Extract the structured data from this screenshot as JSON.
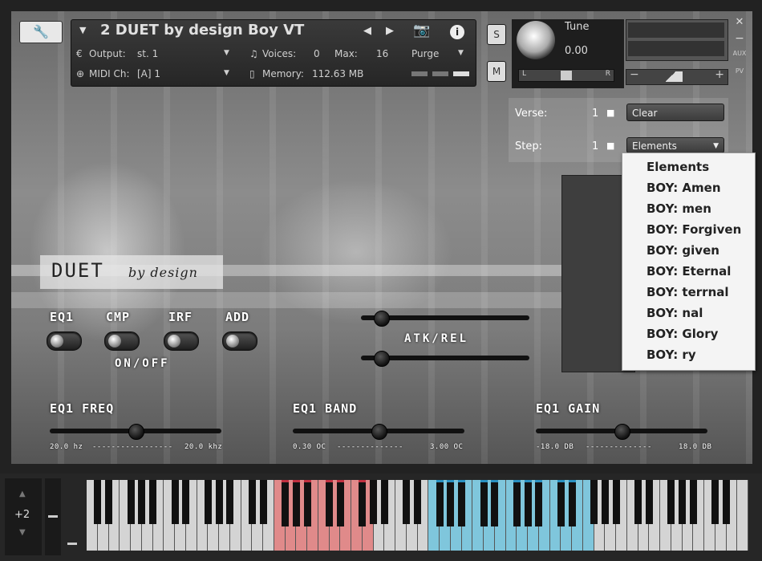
{
  "header": {
    "instrument_name": "2 DUET by design Boy VT",
    "output_label": "Output:",
    "output_value": "st. 1",
    "voices_label": "Voices:",
    "voices_value": "0",
    "max_label": "Max:",
    "max_value": "16",
    "purge_label": "Purge",
    "midi_label": "MIDI Ch:",
    "midi_value": "[A]  1",
    "memory_label": "Memory:",
    "memory_value": "112.63 MB",
    "s_label": "S",
    "m_label": "M",
    "tune_label": "Tune",
    "tune_value": "0.00",
    "pan_l": "L",
    "pan_r": "R",
    "aux_label": "AUX",
    "pv_label": "PV",
    "close_glyph": "✕",
    "minimize_glyph": "−"
  },
  "controls": {
    "verse_label": "Verse:",
    "verse_value": "1",
    "step_label": "Step:",
    "step_value": "1",
    "clear_label": "Clear",
    "elements_label": "Elements"
  },
  "dropdown": {
    "items": [
      "Elements",
      "BOY: Amen",
      "BOY: men",
      "BOY: Forgiven",
      "BOY: given",
      "BOY: Eternal",
      "BOY: terrnal",
      "BOY: nal",
      "BOY: Glory",
      "BOY: ry"
    ]
  },
  "logo": {
    "main": "DUET",
    "script": "by design"
  },
  "toggles": {
    "eq1": "EQ1",
    "cmp": "CMP",
    "irf": "IRF",
    "add": "ADD",
    "onoff": "ON/OFF",
    "atkrel": "ATK/REL"
  },
  "sliders": {
    "eq1_freq": {
      "label": "EQ1 FREQ",
      "min": "20.0 hz",
      "max": "20.0 khz",
      "level": 0.5
    },
    "eq1_band": {
      "label": "EQ1 BAND",
      "min": "0.30 OC",
      "max": "3.00 OC",
      "level": 0.5
    },
    "eq1_gain": {
      "label": "EQ1 GAIN",
      "min": "-18.0 DB",
      "max": "18.0 DB",
      "level": 0.5
    }
  },
  "keyboard": {
    "octave_value": "+2",
    "red_zone_color": "#e08a8a",
    "blue_zone_color": "#7fc6dc"
  },
  "colors": {
    "accent_red": "#e05060",
    "accent_blue": "#3aa8d0"
  }
}
